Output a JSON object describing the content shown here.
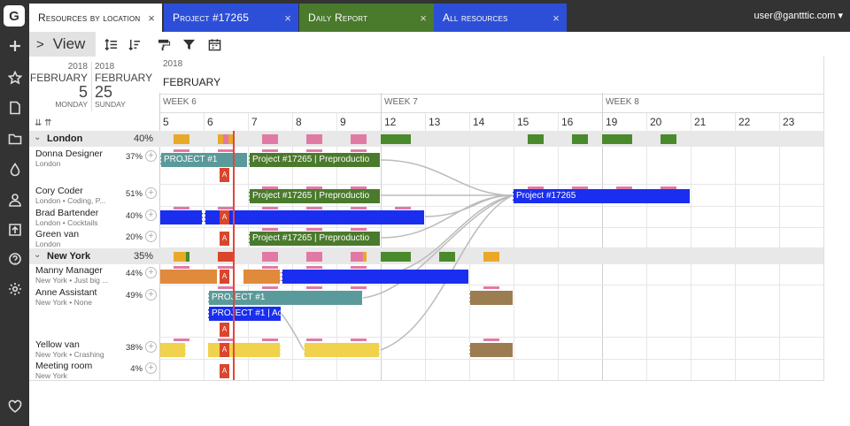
{
  "app": {
    "logo": "G",
    "user": "user@gantttic.com ▾"
  },
  "tabs": [
    {
      "label": "Resources by location",
      "color": "#ffffff",
      "active": true
    },
    {
      "label": "Project #17265",
      "color": "#2d4fd8"
    },
    {
      "label": "Daily Report",
      "color": "#4a7a2c"
    },
    {
      "label": "All resources",
      "color": "#2d4fd8"
    }
  ],
  "toolbar": {
    "view_label": "View"
  },
  "dates": {
    "start": {
      "year": "2018",
      "month": "FEBRUARY",
      "day": "5",
      "weekday": "MONDAY"
    },
    "end": {
      "year": "2018",
      "month": "FEBRUARY",
      "day": "25",
      "weekday": "SUNDAY"
    }
  },
  "timeline": {
    "year": "2018",
    "month": "FEBRUARY",
    "weeks": [
      "WEEK 6",
      "WEEK 7",
      "WEEK 8"
    ],
    "days": [
      "5",
      "6",
      "7",
      "8",
      "9",
      "12",
      "13",
      "14",
      "15",
      "16",
      "19",
      "20",
      "21",
      "22",
      "23"
    ]
  },
  "groups": [
    {
      "name": "London",
      "pct": "40%"
    },
    {
      "name": "New York",
      "pct": "35%"
    }
  ],
  "resources": [
    {
      "name": "Donna Designer",
      "sub": "London",
      "pct": "37%"
    },
    {
      "name": "Cory Coder",
      "sub": "London  •  Coding, P...",
      "pct": "51%"
    },
    {
      "name": "Brad Bartender",
      "sub": "London  •  Cocktails",
      "pct": "40%"
    },
    {
      "name": "Green van",
      "sub": "London",
      "pct": "20%"
    },
    {
      "name": "Manny Manager",
      "sub": "New York  •  Just big ...",
      "pct": "44%"
    },
    {
      "name": "Anne Assistant",
      "sub": "New York  •  None",
      "pct": "49%"
    },
    {
      "name": "Yellow van",
      "sub": "New York  •  Crashing",
      "pct": "38%"
    },
    {
      "name": "Meeting room",
      "sub": "New York",
      "pct": "4%"
    }
  ],
  "tasks": {
    "project1": "PROJECT #1",
    "preprod": "Project #17265 | Preproductio",
    "project17265": "Project #17265",
    "project1_short": "PROJECT #1 | Ac"
  },
  "colors": {
    "teal": "#5b9a9a",
    "green": "#4a7a2c",
    "blue": "#1a2ef0",
    "orange": "#e08a3c",
    "yellow": "#f0d24c",
    "brown": "#9c7d52",
    "amber": "#e8a92a",
    "pink": "#e07aa5",
    "red": "#d9462d"
  }
}
